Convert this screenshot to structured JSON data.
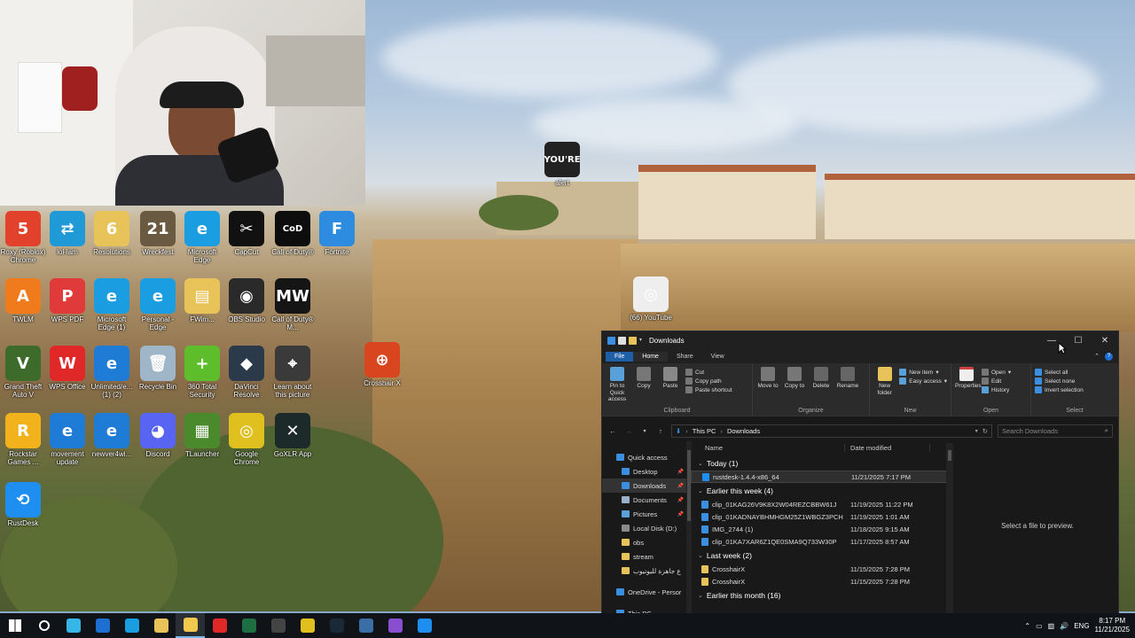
{
  "desktop": {
    "icons": [
      {
        "label": "Roxy (Roblox) Chrome",
        "icon": "roblox-chrome-icon",
        "color": "#e2412b",
        "glyph": "5",
        "col": 0,
        "row": 0
      },
      {
        "label": "lol-lam",
        "icon": "blue-app-icon",
        "color": "#1f9ad6",
        "glyph": "⇄",
        "col": 1,
        "row": 0
      },
      {
        "label": "Resolutions",
        "icon": "folder-icon",
        "color": "#e8c35a",
        "glyph": "6",
        "col": 2,
        "row": 0
      },
      {
        "label": "Wreckfest",
        "icon": "wreckfest-icon",
        "color": "#6b5a42",
        "glyph": "21",
        "col": 3,
        "row": 0
      },
      {
        "label": "Microsoft Edge",
        "icon": "edge-icon",
        "color": "#1b9de2",
        "glyph": "e",
        "col": 4,
        "row": 0
      },
      {
        "label": "CapCut",
        "icon": "capcut-icon",
        "color": "#111111",
        "glyph": "✂",
        "col": 5,
        "row": 0
      },
      {
        "label": "Call of Duty®",
        "icon": "call-of-duty-icon",
        "color": "#0d0d0d",
        "glyph": "CoD",
        "col": 6,
        "row": 0
      },
      {
        "label": "Fortnite",
        "icon": "fortnite-icon",
        "color": "#2d8ce0",
        "glyph": "F",
        "col": 7,
        "row": 0
      },
      {
        "label": "TWLM",
        "icon": "orange-app-icon",
        "color": "#f07b1d",
        "glyph": "A",
        "col": 0,
        "row": 1
      },
      {
        "label": "WPS PDF",
        "icon": "wps-pdf-icon",
        "color": "#e03a3a",
        "glyph": "P",
        "col": 1,
        "row": 1
      },
      {
        "label": "Microsoft Edge (1)",
        "icon": "edge-icon",
        "color": "#1b9de2",
        "glyph": "e",
        "col": 2,
        "row": 1
      },
      {
        "label": "Personal - Edge",
        "icon": "edge-icon",
        "color": "#1b9de2",
        "glyph": "e",
        "col": 3,
        "row": 1
      },
      {
        "label": "FWim...",
        "icon": "folder-icon",
        "color": "#e8c35a",
        "glyph": "▤",
        "col": 4,
        "row": 1
      },
      {
        "label": "OBS Studio",
        "icon": "obs-icon",
        "color": "#2a2a2a",
        "glyph": "◉",
        "col": 5,
        "row": 1
      },
      {
        "label": "Call of Duty® M...",
        "icon": "mw3-icon",
        "color": "#151515",
        "glyph": "MW",
        "col": 6,
        "row": 1
      },
      {
        "label": "Grand Theft Auto V",
        "icon": "gta-icon",
        "color": "#3c6b2c",
        "glyph": "V",
        "col": 0,
        "row": 2
      },
      {
        "label": "WPS Office",
        "icon": "wps-office-icon",
        "color": "#e02828",
        "glyph": "W",
        "col": 1,
        "row": 2
      },
      {
        "label": "Unlimited/e... (1) (2)",
        "icon": "ie-icon",
        "color": "#1e7bd6",
        "glyph": "e",
        "col": 2,
        "row": 2
      },
      {
        "label": "Recycle Bin",
        "icon": "recycle-bin-icon",
        "color": "#9fb6c8",
        "glyph": "🗑",
        "col": 3,
        "row": 2
      },
      {
        "label": "360 Total Security",
        "icon": "360-security-icon",
        "color": "#5dbd2a",
        "glyph": "+",
        "col": 4,
        "row": 2
      },
      {
        "label": "DaVinci Resolve",
        "icon": "davinci-icon",
        "color": "#2b3a4a",
        "glyph": "◆",
        "col": 5,
        "row": 2
      },
      {
        "label": "Learn about this picture",
        "icon": "learn-picture-icon",
        "color": "#3a3a3a",
        "glyph": "⌖",
        "col": 6,
        "row": 2
      },
      {
        "label": "Rockstar Games ...",
        "icon": "rockstar-icon",
        "color": "#f2b21b",
        "glyph": "R",
        "col": 0,
        "row": 3
      },
      {
        "label": "movement update",
        "icon": "ie-icon",
        "color": "#1e7bd6",
        "glyph": "e",
        "col": 1,
        "row": 3
      },
      {
        "label": "newver4wi...",
        "icon": "ie-icon",
        "color": "#1e7bd6",
        "glyph": "e",
        "col": 2,
        "row": 3
      },
      {
        "label": "Discord",
        "icon": "discord-icon",
        "color": "#5865f2",
        "glyph": "◕",
        "col": 3,
        "row": 3
      },
      {
        "label": "TLauncher",
        "icon": "tlauncher-icon",
        "color": "#4b8a2c",
        "glyph": "▦",
        "col": 4,
        "row": 3
      },
      {
        "label": "Google Chrome",
        "icon": "chrome-icon",
        "color": "#e0c01f",
        "glyph": "◎",
        "col": 5,
        "row": 3
      },
      {
        "label": "GoXLR App",
        "icon": "goxlr-icon",
        "color": "#1c2a2a",
        "glyph": "✕",
        "col": 6,
        "row": 3
      },
      {
        "label": "RustDesk",
        "icon": "rustdesk-icon",
        "color": "#1f8ef1",
        "glyph": "⟲",
        "col": 0,
        "row": 4
      }
    ],
    "extra_icons": [
      {
        "label": "alert",
        "icon": "alert-icon",
        "color": "#222222",
        "glyph": "YOU'RE",
        "pos": "alert"
      },
      {
        "label": "(66) YouTube",
        "icon": "chrome-icon",
        "color": "#ffffff",
        "glyph": "◎",
        "pos": "youtube"
      },
      {
        "label": "Crosshair X",
        "icon": "crosshair-icon",
        "color": "#d8451f",
        "glyph": "⊕",
        "pos": "crosshair"
      }
    ]
  },
  "explorer": {
    "title": "Downloads",
    "tabs": [
      "File",
      "Home",
      "Share",
      "View"
    ],
    "ribbon": {
      "clipboard": {
        "name": "Clipboard",
        "pin": "Pin to Quick access",
        "copy": "Copy",
        "paste": "Paste",
        "cut": "Cut",
        "copy_path": "Copy path",
        "paste_shortcut": "Paste shortcut"
      },
      "organize": {
        "name": "Organize",
        "move_to": "Move to",
        "copy_to": "Copy to",
        "delete": "Delete",
        "rename": "Rename"
      },
      "new": {
        "name": "New",
        "new_folder": "New folder",
        "new_item": "New item",
        "easy_access": "Easy access"
      },
      "open": {
        "name": "Open",
        "properties": "Properties",
        "open": "Open",
        "edit": "Edit",
        "history": "History"
      },
      "select": {
        "name": "Select",
        "select_all": "Select all",
        "select_none": "Select none",
        "invert": "Invert selection"
      }
    },
    "address": {
      "crumbs": [
        "This PC",
        "Downloads"
      ],
      "search_placeholder": "Search Downloads"
    },
    "nav": [
      {
        "label": "Quick access",
        "icon": "star-icon",
        "color": "#3b8fe0",
        "pinned": false,
        "selected": false
      },
      {
        "label": "Desktop",
        "icon": "desktop-icon",
        "color": "#3b8fe0",
        "pinned": true,
        "selected": false
      },
      {
        "label": "Downloads",
        "icon": "download-icon",
        "color": "#3b8fe0",
        "pinned": true,
        "selected": true
      },
      {
        "label": "Documents",
        "icon": "documents-icon",
        "color": "#9ab0c8",
        "pinned": true,
        "selected": false
      },
      {
        "label": "Pictures",
        "icon": "pictures-icon",
        "color": "#5aa0d8",
        "pinned": true,
        "selected": false
      },
      {
        "label": "Local Disk (D:)",
        "icon": "drive-icon",
        "color": "#8a8a8a",
        "pinned": false,
        "selected": false
      },
      {
        "label": "obs",
        "icon": "folder-icon",
        "color": "#e8c35a",
        "pinned": false,
        "selected": false
      },
      {
        "label": "stream",
        "icon": "folder-icon",
        "color": "#e8c35a",
        "pinned": false,
        "selected": false
      },
      {
        "label": "ع جاهزة لليوتيوب",
        "icon": "folder-icon",
        "color": "#e8c35a",
        "pinned": false,
        "selected": false
      },
      {
        "label": "",
        "icon": "spacer",
        "color": "",
        "pinned": false,
        "selected": false
      },
      {
        "label": "OneDrive - Persor",
        "icon": "onedrive-icon",
        "color": "#3b8fe0",
        "pinned": false,
        "selected": false
      },
      {
        "label": "",
        "icon": "spacer",
        "color": "",
        "pinned": false,
        "selected": false
      },
      {
        "label": "This PC",
        "icon": "this-pc-icon",
        "color": "#3b8fe0",
        "pinned": false,
        "selected": false
      }
    ],
    "columns": {
      "name": "Name",
      "date": "Date modified"
    },
    "groups": [
      {
        "title": "Today (1)",
        "files": [
          {
            "name": "rustdesk-1.4.4-x86_64",
            "date": "11/21/2025 7:17 PM",
            "icon": "rustdesk-file-icon",
            "color": "#1f8ef1",
            "selected": true
          }
        ]
      },
      {
        "title": "Earlier this week (4)",
        "files": [
          {
            "name": "clip_01KAG26V9K8X2W04REZCBBW61J",
            "date": "11/19/2025 11:22 PM",
            "icon": "video-file-icon",
            "color": "#3b8fe0",
            "selected": false
          },
          {
            "name": "clip_01KADNAYBHMHGM25Z1WBGZ3PCH",
            "date": "11/19/2025 1:01 AM",
            "icon": "video-file-icon",
            "color": "#3b8fe0",
            "selected": false
          },
          {
            "name": "IMG_2744 (1)",
            "date": "11/18/2025 9:15 AM",
            "icon": "video-file-icon",
            "color": "#3b8fe0",
            "selected": false
          },
          {
            "name": "clip_01KA7XAR6Z1QE0SMA9Q733W30P",
            "date": "11/17/2025 8:57 AM",
            "icon": "video-file-icon",
            "color": "#3b8fe0",
            "selected": false
          }
        ]
      },
      {
        "title": "Last week (2)",
        "files": [
          {
            "name": "CrosshairX",
            "date": "11/15/2025 7:28 PM",
            "icon": "folder-icon",
            "color": "#e8c35a",
            "selected": false
          },
          {
            "name": "CrosshairX",
            "date": "11/15/2025 7:28 PM",
            "icon": "folder-icon",
            "color": "#e8c35a",
            "selected": false
          }
        ]
      },
      {
        "title": "Earlier this month (16)",
        "files": []
      }
    ],
    "preview_text": "Select a file to preview."
  },
  "taskbar": {
    "items": [
      {
        "icon": "windows-start-icon",
        "color": "#ffffff",
        "active": false
      },
      {
        "icon": "search-icon",
        "color": "#ffffff",
        "active": false
      },
      {
        "icon": "copilot-icon",
        "color": "#35b5e8",
        "active": false
      },
      {
        "icon": "outlook-icon",
        "color": "#1d6fd1",
        "active": false
      },
      {
        "icon": "edge-icon",
        "color": "#1b9de2",
        "active": false
      },
      {
        "icon": "store-icon",
        "color": "#e8c35a",
        "active": false
      },
      {
        "icon": "file-explorer-icon",
        "color": "#f2c94c",
        "active": true
      },
      {
        "icon": "wps-office-icon",
        "color": "#e02828",
        "active": false
      },
      {
        "icon": "excel-icon",
        "color": "#1d6f42",
        "active": false
      },
      {
        "icon": "obs-icon",
        "color": "#444444",
        "active": false
      },
      {
        "icon": "chrome-icon",
        "color": "#e0c01f",
        "active": false
      },
      {
        "icon": "steam-icon",
        "color": "#1b2838",
        "active": false
      },
      {
        "icon": "security-shield-icon",
        "color": "#3a6ea5",
        "active": false
      },
      {
        "icon": "purple-app-icon",
        "color": "#8a4fd1",
        "active": false
      },
      {
        "icon": "rustdesk-icon",
        "color": "#1f8ef1",
        "active": false
      }
    ],
    "tray": {
      "language": "ENG",
      "time": "8:17 PM",
      "date": "11/21/2025"
    }
  }
}
